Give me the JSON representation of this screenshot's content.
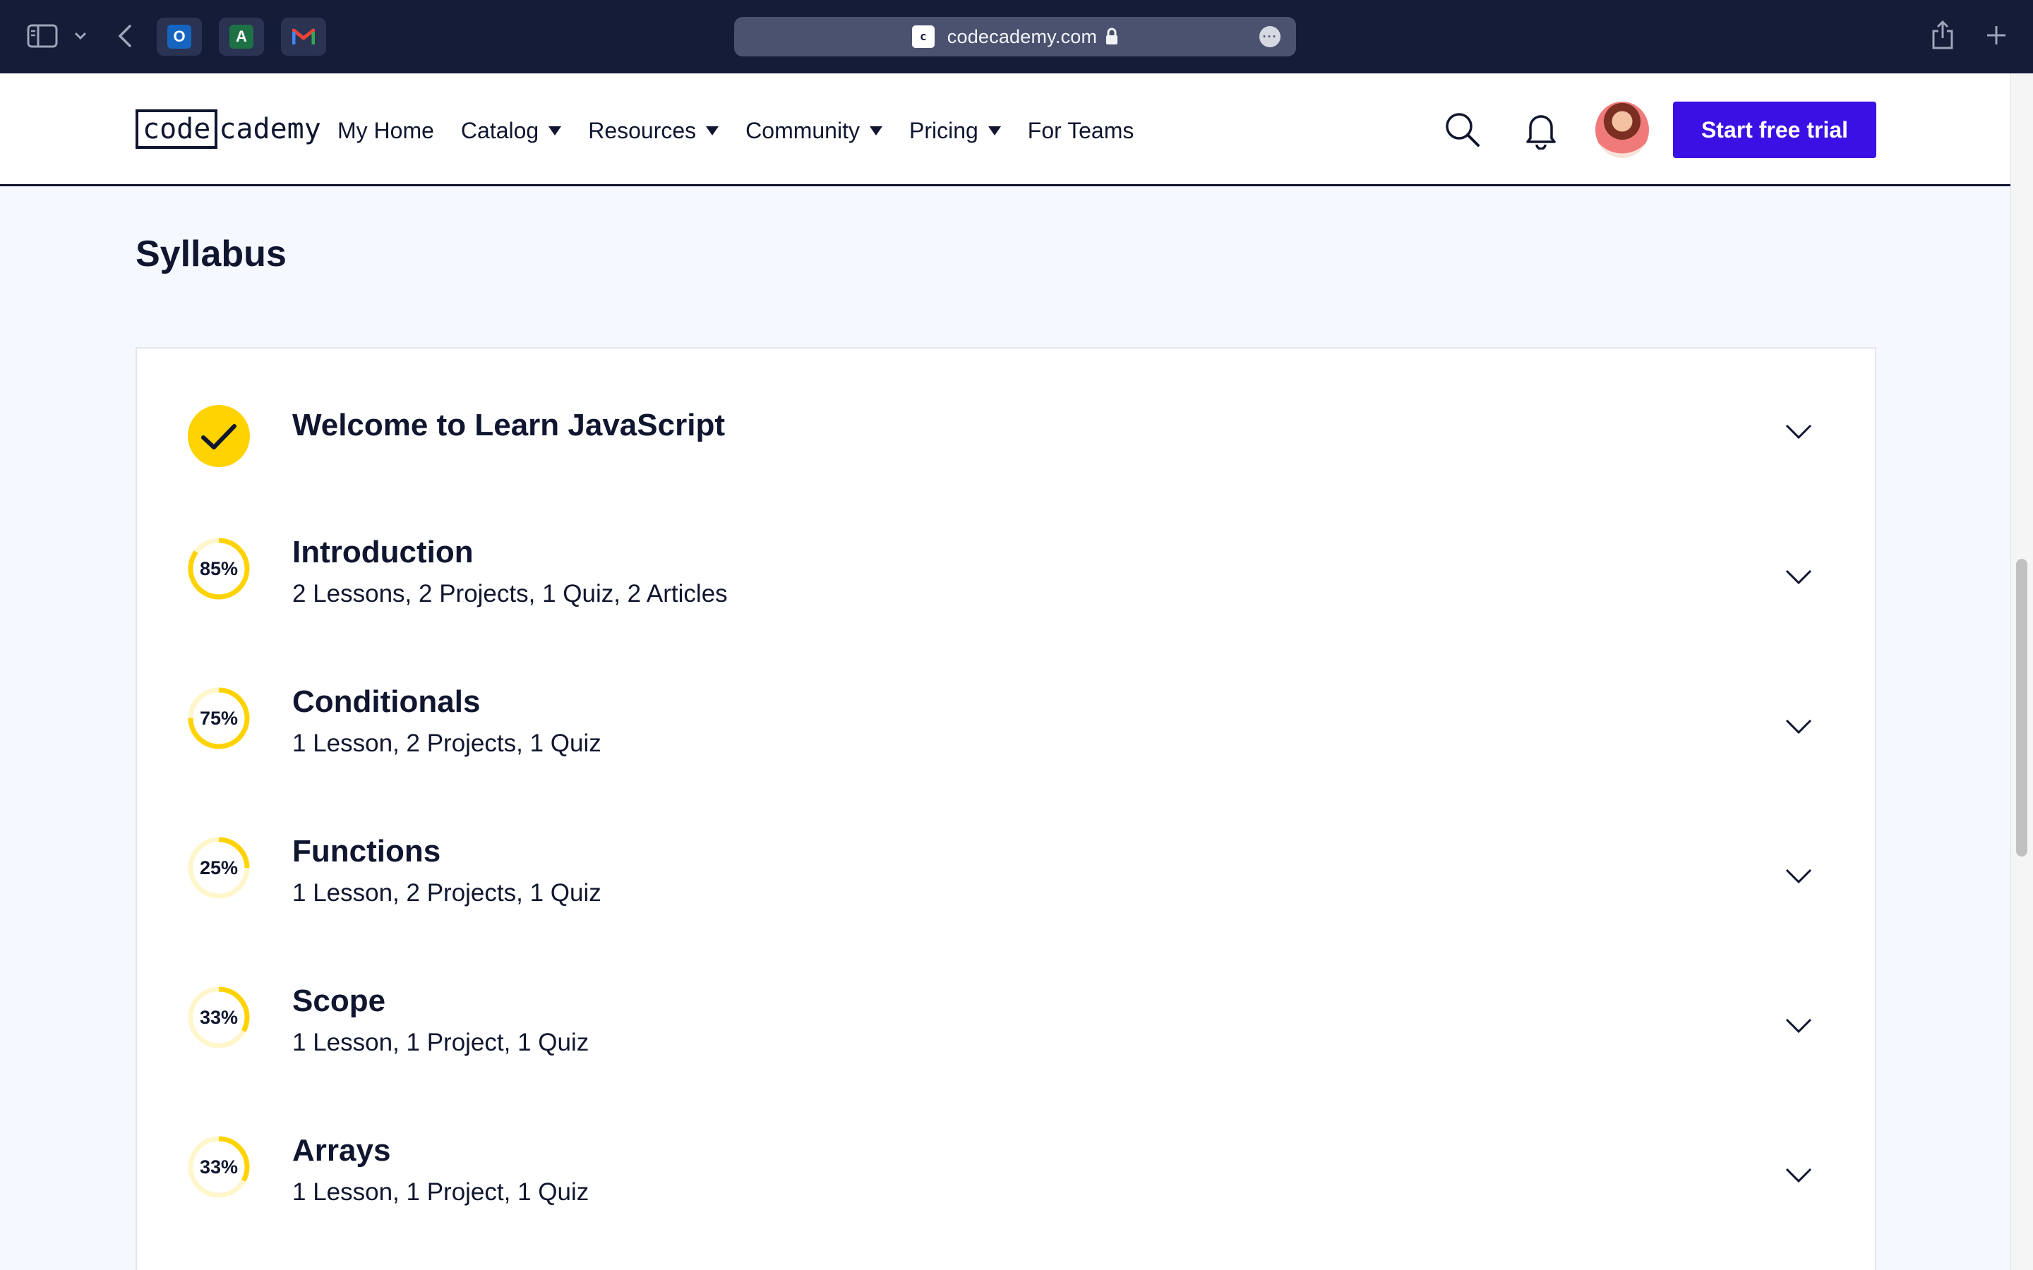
{
  "browser": {
    "url": "codecademy.com",
    "favorites": [
      {
        "name": "Outlook",
        "color": "#1565c0"
      },
      {
        "name": "Excel",
        "color": "#1e7145"
      },
      {
        "name": "Gmail",
        "color": "#ea4335"
      }
    ]
  },
  "header": {
    "logo_code": "code",
    "logo_rest": "cademy",
    "nav": [
      {
        "label": "My Home",
        "has_caret": false
      },
      {
        "label": "Catalog",
        "has_caret": true
      },
      {
        "label": "Resources",
        "has_caret": true
      },
      {
        "label": "Community",
        "has_caret": true
      },
      {
        "label": "Pricing",
        "has_caret": true
      },
      {
        "label": "For Teams",
        "has_caret": false
      }
    ],
    "cta_label": "Start free trial",
    "cta_color": "#3a10e5"
  },
  "main": {
    "title": "Syllabus",
    "modules": [
      {
        "title": "Welcome to Learn JavaScript",
        "meta": "",
        "status": "complete",
        "progress": 1.0
      },
      {
        "title": "Introduction",
        "meta": "2 Lessons, 2 Projects, 1 Quiz, 2 Articles",
        "status": "in-progress",
        "progress": 0.85,
        "progress_label": "85%"
      },
      {
        "title": "Conditionals",
        "meta": "1 Lesson, 2 Projects, 1 Quiz",
        "status": "in-progress",
        "progress": 0.75,
        "progress_label": "75%"
      },
      {
        "title": "Functions",
        "meta": "1 Lesson, 2 Projects, 1 Quiz",
        "status": "in-progress",
        "progress": 0.25,
        "progress_label": "25%"
      },
      {
        "title": "Scope",
        "meta": "1 Lesson, 1 Project, 1 Quiz",
        "status": "in-progress",
        "progress": 0.33,
        "progress_label": "33%"
      },
      {
        "title": "Arrays",
        "meta": "1 Lesson, 1 Project, 1 Quiz",
        "status": "in-progress",
        "progress": 0.33,
        "progress_label": "33%"
      }
    ]
  },
  "colors": {
    "progress_ring": "#ffd300",
    "progress_track": "#fff6cc",
    "ink": "#10162f"
  }
}
